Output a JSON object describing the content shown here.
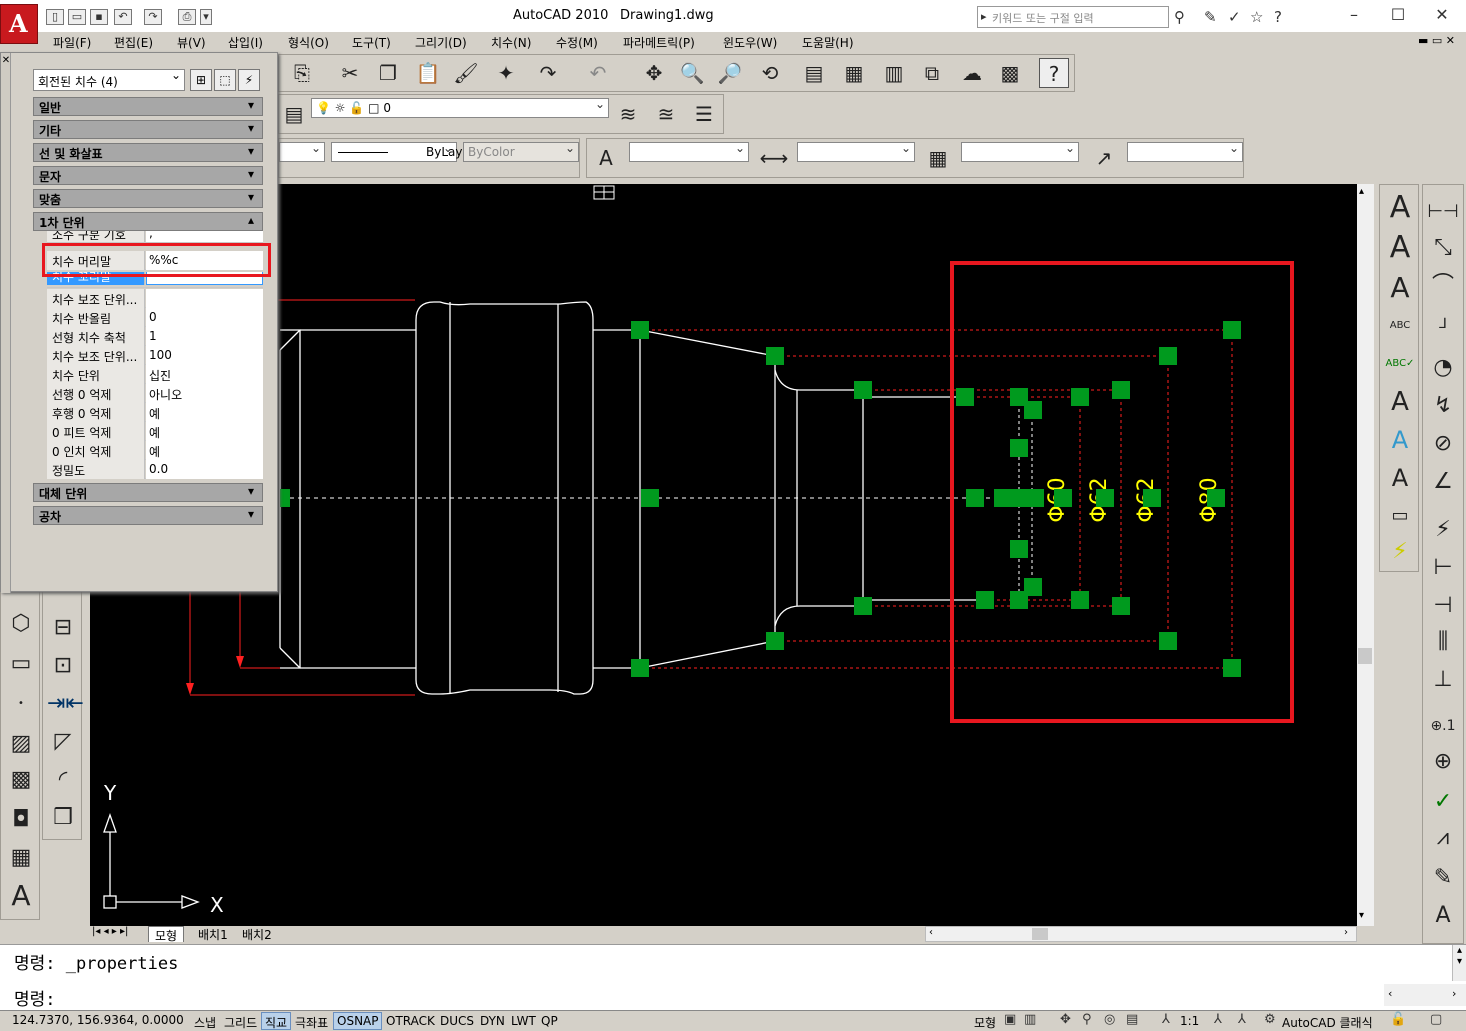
{
  "app": {
    "title": "AutoCAD 2010",
    "file": "Drawing1.dwg",
    "search_placeholder": "키워드 또는 구절 입력"
  },
  "menu": [
    "파일(F)",
    "편집(E)",
    "뷰(V)",
    "삽입(I)",
    "형식(O)",
    "도구(T)",
    "그리기(D)",
    "치수(N)",
    "수정(M)",
    "파라메트릭(P)",
    "윈도우(W)",
    "도움말(H)"
  ],
  "layer_toolbar": {
    "layer_name": "0"
  },
  "properties_toolbar": {
    "linetype": "ByLayer",
    "plotstyle": "ByColor"
  },
  "properties_panel": {
    "selection": "회전된 치수 (4)",
    "categories": {
      "general": "일반",
      "misc": "기타",
      "lines_arrows": "선 및 화살표",
      "text": "문자",
      "fit": "맞춤",
      "primary_units": "1차 단위",
      "alt_units": "대체 단위",
      "tolerances": "공차"
    },
    "rows": [
      {
        "key": "소수 구분 기호",
        "value": ","
      },
      {
        "key": "치수 머리말",
        "value": "%%c"
      },
      {
        "key": "치수 꼬리말",
        "value": ""
      },
      {
        "key": "치수 보조 단위...",
        "value": ""
      },
      {
        "key": "치수 반올림",
        "value": "0"
      },
      {
        "key": "선형 치수 축척",
        "value": "1"
      },
      {
        "key": "치수 보조 단위...",
        "value": "100"
      },
      {
        "key": "치수 단위",
        "value": "십진"
      },
      {
        "key": "선행 0 억제",
        "value": "아니오"
      },
      {
        "key": "후행 0 억제",
        "value": "예"
      },
      {
        "key": "0 피트 억제",
        "value": "예"
      },
      {
        "key": "0 인치 억제",
        "value": "예"
      },
      {
        "key": "정밀도",
        "value": "0.0"
      }
    ]
  },
  "drawing": {
    "dim_labels": [
      "Φ60",
      "Φ62",
      "Φ62",
      "Φ80"
    ],
    "ucs_x": "X",
    "ucs_y": "Y",
    "colors": {
      "geometry": "#ffffff",
      "dim": "#ff2020",
      "grip": "#009a1e",
      "dimtext": "#ffff00",
      "highlight": "#e8171f"
    }
  },
  "layout_tabs": [
    "모형",
    "배치1",
    "배치2"
  ],
  "command": {
    "history": "명령: _properties",
    "prompt": "명령:"
  },
  "status": {
    "coords": "124.7370, 156.9364, 0.0000",
    "toggles": [
      {
        "label": "스냅",
        "on": false
      },
      {
        "label": "그리드",
        "on": false
      },
      {
        "label": "직교",
        "on": true
      },
      {
        "label": "극좌표",
        "on": false
      },
      {
        "label": "OSNAP",
        "on": true
      },
      {
        "label": "OTRACK",
        "on": false
      },
      {
        "label": "DUCS",
        "on": false
      },
      {
        "label": "DYN",
        "on": false
      },
      {
        "label": "LWT",
        "on": false
      },
      {
        "label": "QP",
        "on": false
      }
    ],
    "model": "모형",
    "scale": "1:1",
    "workspace": "AutoCAD 클래식"
  }
}
